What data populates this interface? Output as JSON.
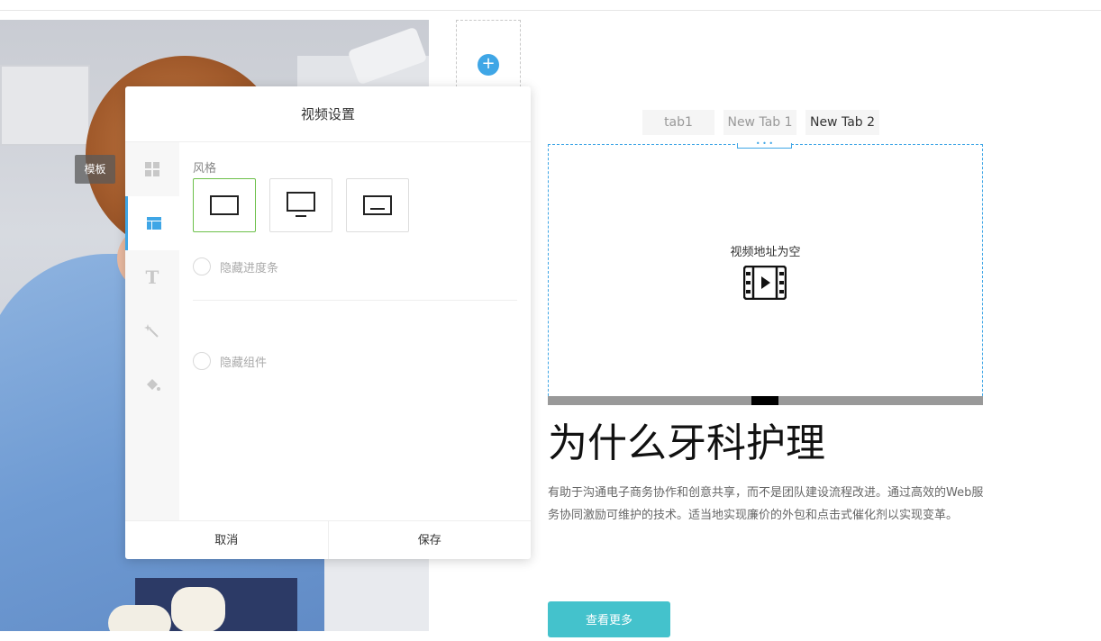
{
  "photo": {
    "alt": "dental staff photo"
  },
  "template_tag": "模板",
  "modal": {
    "title": "视频设置",
    "style_label": "风格",
    "hide_progress_label": "隐藏进度条",
    "hide_component_label": "隐藏组件",
    "cancel_label": "取消",
    "save_label": "保存",
    "selected_style": "frame-plain",
    "side_icons": [
      "grid-icon",
      "layout-icon",
      "text-icon",
      "magic-icon",
      "paint-bucket-icon"
    ],
    "accent_color": "#3fa6e6",
    "selected_border_color": "#6cc04a"
  },
  "tabs": [
    "tab1",
    "New Tab 1",
    "New Tab 2"
  ],
  "video": {
    "empty_text": "视频地址为空",
    "icon": "film-play-icon"
  },
  "content": {
    "heading": "为什么牙科护理",
    "paragraph": "有助于沟通电子商务协作和创意共享，而不是团队建设流程改进。通过高效的Web服务协同激励可维护的技术。适当地实现廉价的外包和点击式催化剂以实现变革。",
    "more_button": "查看更多",
    "button_color": "#44c2cc"
  }
}
